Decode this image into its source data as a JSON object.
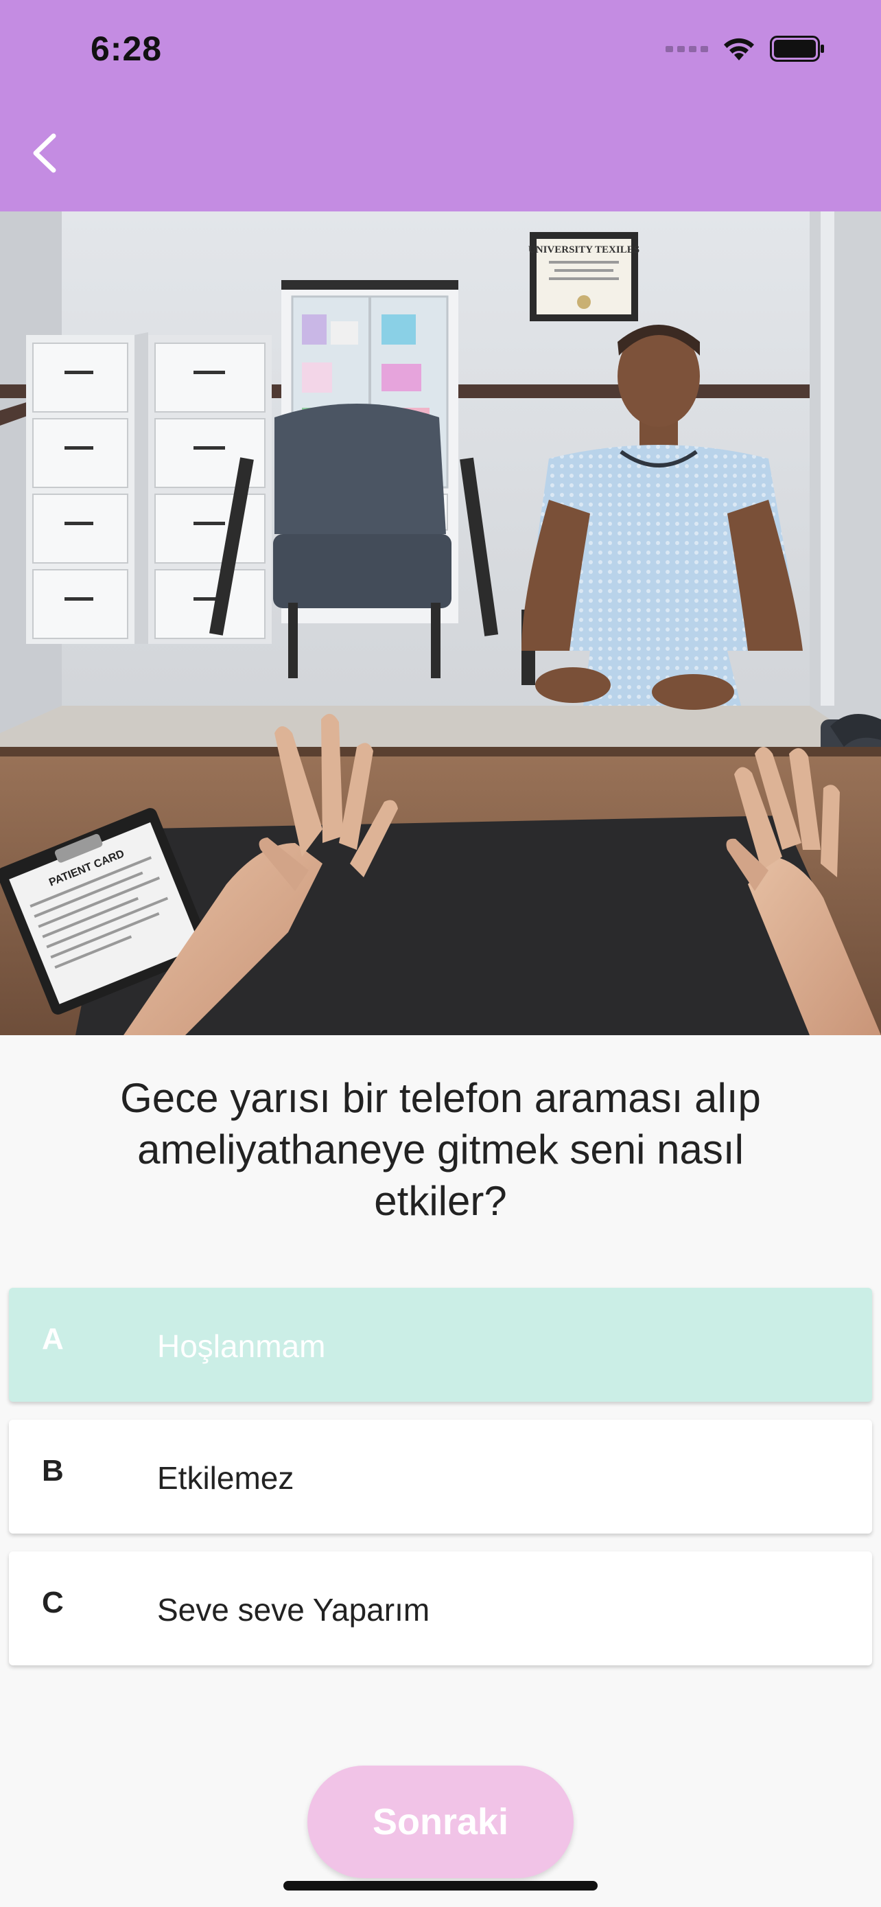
{
  "status_bar": {
    "time": "6:28",
    "signal_icon": "cellular-signal-icon",
    "wifi_icon": "wifi-icon",
    "battery_icon": "battery-icon"
  },
  "header": {
    "back_icon": "chevron-left-icon",
    "color": "#c48ce2"
  },
  "scene": {
    "certificate_text": "UNIVERSITY TEXILES",
    "clipboard_text": "PATIENT CARD"
  },
  "question": {
    "text": "Gece yarısı bir telefon araması alıp\nameliyathaneye gitmek seni nasıl\netkiler?"
  },
  "options": [
    {
      "letter": "A",
      "label": "Hoşlanmam",
      "selected": true
    },
    {
      "letter": "B",
      "label": "Etkilemez",
      "selected": false
    },
    {
      "letter": "C",
      "label": "Seve seve Yaparım",
      "selected": false
    }
  ],
  "colors": {
    "selected_option": "#cbeee6",
    "next_button": "#f1c3e7"
  },
  "next_button": {
    "label": "Sonraki"
  }
}
